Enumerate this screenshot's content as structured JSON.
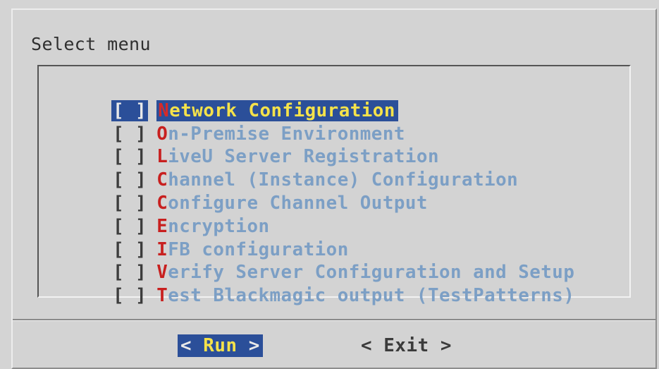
{
  "dialog": {
    "prompt": "Select menu"
  },
  "menu": {
    "items": [
      {
        "hotkey": "N",
        "rest": "etwork Configuration",
        "check": "[ ]",
        "selected": true
      },
      {
        "hotkey": "O",
        "rest": "n-Premise Environment",
        "check": "[ ]",
        "selected": false
      },
      {
        "hotkey": "L",
        "rest": "iveU Server Registration",
        "check": "[ ]",
        "selected": false
      },
      {
        "hotkey": "C",
        "rest": "hannel (Instance) Configuration",
        "check": "[ ]",
        "selected": false
      },
      {
        "hotkey": "C",
        "rest": "onfigure Channel Output",
        "check": "[ ]",
        "selected": false
      },
      {
        "hotkey": "E",
        "rest": "ncryption",
        "check": "[ ]",
        "selected": false
      },
      {
        "hotkey": "I",
        "rest": "FB configuration",
        "check": "[ ]",
        "selected": false
      },
      {
        "hotkey": "V",
        "rest": "erify Server Configuration and Setup",
        "check": "[ ]",
        "selected": false
      },
      {
        "hotkey": "T",
        "rest": "est Blackmagic output (TestPatterns)",
        "check": "[ ]",
        "selected": false
      }
    ]
  },
  "buttons": {
    "run": {
      "left": "<",
      "label": " Run ",
      "right": ">"
    },
    "exit": {
      "label": "< Exit >"
    }
  },
  "colors": {
    "dialog_bg": "#d3d3d3",
    "selection_bg": "#2b4f99",
    "selected_text": "#f5e24a",
    "hotkey": "#c8201f",
    "item_text": "#7c9fc5"
  }
}
